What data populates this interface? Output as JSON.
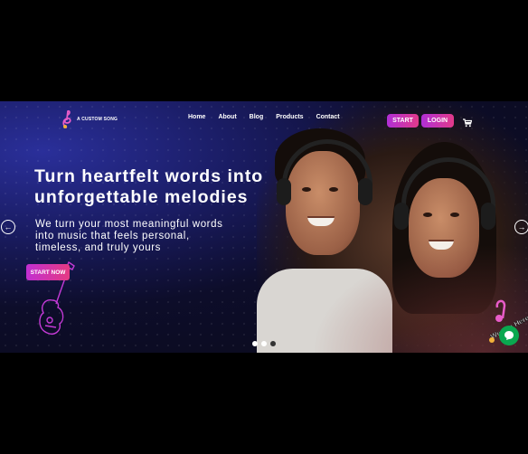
{
  "brand": {
    "name": "A CUSTOM SONG"
  },
  "nav": {
    "items": [
      {
        "label": "Home"
      },
      {
        "label": "About"
      },
      {
        "label": "Blog"
      },
      {
        "label": "Products"
      },
      {
        "label": "Contact"
      }
    ]
  },
  "header": {
    "start_label": "START",
    "login_label": "LOGIN"
  },
  "hero": {
    "headline_line1": "Turn heartfelt words into",
    "headline_line2": "unforgettable melodies",
    "sub_line1": "We turn your most meaningful words",
    "sub_line2": "into music that feels personal,",
    "sub_line3": "timeless, and truly yours",
    "cta_label": "START NOW"
  },
  "carousel": {
    "prev_icon": "left-arrow-icon",
    "next_icon": "right-arrow-icon",
    "slides": 3,
    "active_slide": 2
  },
  "badge": {
    "text": "We Are Here!"
  },
  "colors": {
    "accent_start": "#b02fd6",
    "accent_end": "#e13a8a",
    "chat_green": "#0aa84f"
  }
}
